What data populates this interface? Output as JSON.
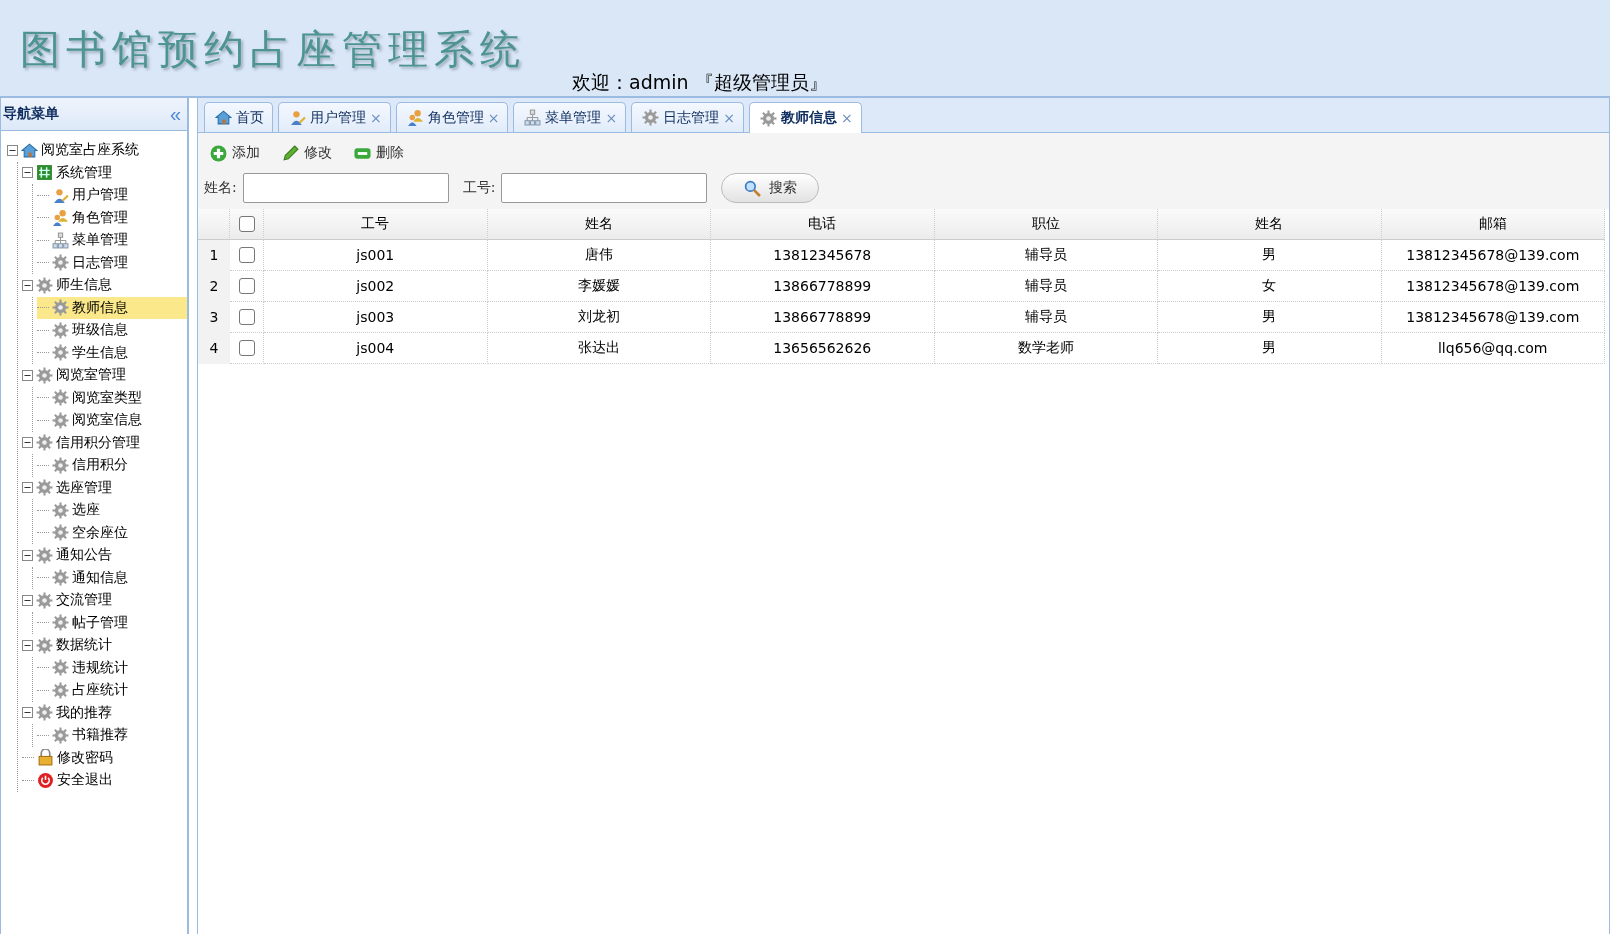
{
  "header": {
    "title": "图书馆预约占座管理系统",
    "welcome": "欢迎：admin 『超级管理员』"
  },
  "sidebar": {
    "title": "导航菜单",
    "collapse_glyph": "«",
    "tree": [
      {
        "label": "阅览室占座系统",
        "kind": "home",
        "expanded": true,
        "selected": false,
        "children": [
          {
            "label": "系统管理",
            "kind": "hash",
            "expanded": true,
            "selected": false,
            "children": [
              {
                "label": "用户管理",
                "kind": "user",
                "selected": false
              },
              {
                "label": "角色管理",
                "kind": "users",
                "selected": false
              },
              {
                "label": "菜单管理",
                "kind": "sitemap",
                "selected": false
              },
              {
                "label": "日志管理",
                "kind": "gear",
                "selected": false
              }
            ]
          },
          {
            "label": "师生信息",
            "kind": "gear",
            "expanded": true,
            "selected": false,
            "children": [
              {
                "label": "教师信息",
                "kind": "gear",
                "selected": true
              },
              {
                "label": "班级信息",
                "kind": "gear",
                "selected": false
              },
              {
                "label": "学生信息",
                "kind": "gear",
                "selected": false
              }
            ]
          },
          {
            "label": "阅览室管理",
            "kind": "gear",
            "expanded": true,
            "selected": false,
            "children": [
              {
                "label": "阅览室类型",
                "kind": "gear",
                "selected": false
              },
              {
                "label": "阅览室信息",
                "kind": "gear",
                "selected": false
              }
            ]
          },
          {
            "label": "信用积分管理",
            "kind": "gear",
            "expanded": true,
            "selected": false,
            "children": [
              {
                "label": "信用积分",
                "kind": "gear",
                "selected": false
              }
            ]
          },
          {
            "label": "选座管理",
            "kind": "gear",
            "expanded": true,
            "selected": false,
            "children": [
              {
                "label": "选座",
                "kind": "gear",
                "selected": false
              },
              {
                "label": "空余座位",
                "kind": "gear",
                "selected": false
              }
            ]
          },
          {
            "label": "通知公告",
            "kind": "gear",
            "expanded": true,
            "selected": false,
            "children": [
              {
                "label": "通知信息",
                "kind": "gear",
                "selected": false
              }
            ]
          },
          {
            "label": "交流管理",
            "kind": "gear",
            "expanded": true,
            "selected": false,
            "children": [
              {
                "label": "帖子管理",
                "kind": "gear",
                "selected": false
              }
            ]
          },
          {
            "label": "数据统计",
            "kind": "gear",
            "expanded": true,
            "selected": false,
            "children": [
              {
                "label": "违规统计",
                "kind": "gear",
                "selected": false
              },
              {
                "label": "占座统计",
                "kind": "gear",
                "selected": false
              }
            ]
          },
          {
            "label": "我的推荐",
            "kind": "gear",
            "expanded": true,
            "selected": false,
            "children": [
              {
                "label": "书籍推荐",
                "kind": "gear",
                "selected": false
              }
            ]
          },
          {
            "label": "修改密码",
            "kind": "lock",
            "selected": false
          },
          {
            "label": "安全退出",
            "kind": "exit",
            "selected": false
          }
        ]
      }
    ]
  },
  "tabs": [
    {
      "label": "首页",
      "kind": "home",
      "selected": false,
      "closable": false
    },
    {
      "label": "用户管理",
      "kind": "user",
      "selected": false,
      "closable": true
    },
    {
      "label": "角色管理",
      "kind": "users",
      "selected": false,
      "closable": true
    },
    {
      "label": "菜单管理",
      "kind": "sitemap",
      "selected": false,
      "closable": true
    },
    {
      "label": "日志管理",
      "kind": "gear",
      "selected": false,
      "closable": true
    },
    {
      "label": "教师信息",
      "kind": "gear",
      "selected": true,
      "closable": true
    }
  ],
  "close_glyph": "×",
  "toolbar": [
    {
      "label": "添加",
      "kind": "add"
    },
    {
      "label": "修改",
      "kind": "edit"
    },
    {
      "label": "删除",
      "kind": "remove"
    }
  ],
  "search": {
    "fields": [
      {
        "label": "姓名:"
      },
      {
        "label": "工号:"
      }
    ],
    "button": "搜索"
  },
  "table": {
    "header_checked": false,
    "columns": [
      "工号",
      "姓名",
      "电话",
      "职位",
      "姓名",
      "邮箱"
    ],
    "rows": [
      {
        "number": "1",
        "checked": false,
        "cells": [
          "js001",
          "唐伟",
          "13812345678",
          "辅导员",
          "男",
          "13812345678@139.com"
        ]
      },
      {
        "number": "2",
        "checked": false,
        "cells": [
          "js002",
          "李媛媛",
          "13866778899",
          "辅导员",
          "女",
          "13812345678@139.com"
        ]
      },
      {
        "number": "3",
        "checked": false,
        "cells": [
          "js003",
          "刘龙初",
          "13866778899",
          "辅导员",
          "男",
          "13812345678@139.com"
        ]
      },
      {
        "number": "4",
        "checked": false,
        "cells": [
          "js004",
          "张达出",
          "13656562626",
          "数学老师",
          "男",
          "llq656@qq.com"
        ]
      }
    ]
  }
}
